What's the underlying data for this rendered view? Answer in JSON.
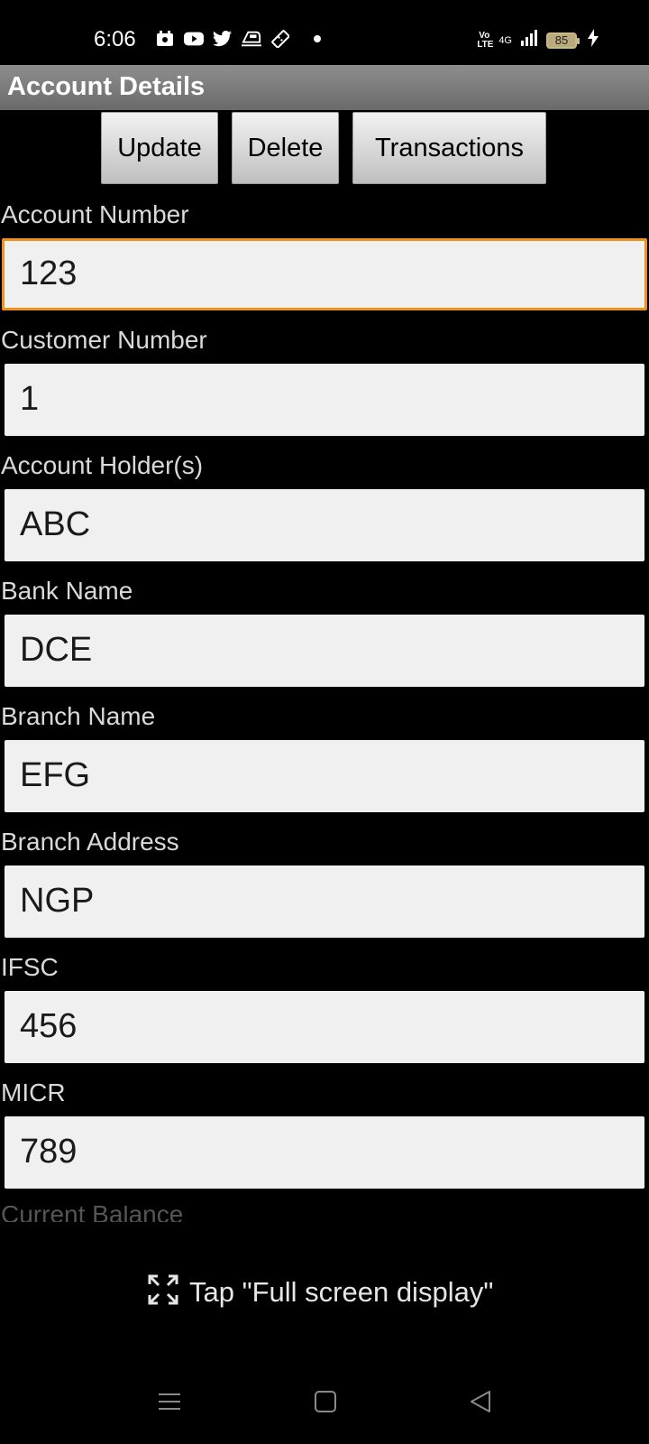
{
  "status_bar": {
    "time": "6:06",
    "left_icons": [
      "gallery-icon",
      "youtube-icon",
      "twitter-icon",
      "train-icon",
      "ticket-icon"
    ],
    "network_label": "4G",
    "volte_label": "Vo LTE",
    "battery_level": "85"
  },
  "title_bar": {
    "title": "Account Details"
  },
  "actions": {
    "update_label": "Update",
    "delete_label": "Delete",
    "transactions_label": "Transactions"
  },
  "form": {
    "fields": [
      {
        "label": "Account Number",
        "value": "123"
      },
      {
        "label": "Customer Number",
        "value": "1"
      },
      {
        "label": "Account Holder(s)",
        "value": "ABC"
      },
      {
        "label": "Bank Name",
        "value": "DCE"
      },
      {
        "label": "Branch Name",
        "value": "EFG"
      },
      {
        "label": "Branch Address",
        "value": "NGP"
      },
      {
        "label": "IFSC",
        "value": "456"
      },
      {
        "label": "MICR",
        "value": "789"
      }
    ],
    "partial_label": "Current Balance"
  },
  "fullscreen_hint": {
    "text": "Tap \"Full screen display\""
  },
  "colors": {
    "focus_border": "#f0901f",
    "title_bar": "#7a7a7a",
    "field_bg": "#f0f0f0"
  }
}
